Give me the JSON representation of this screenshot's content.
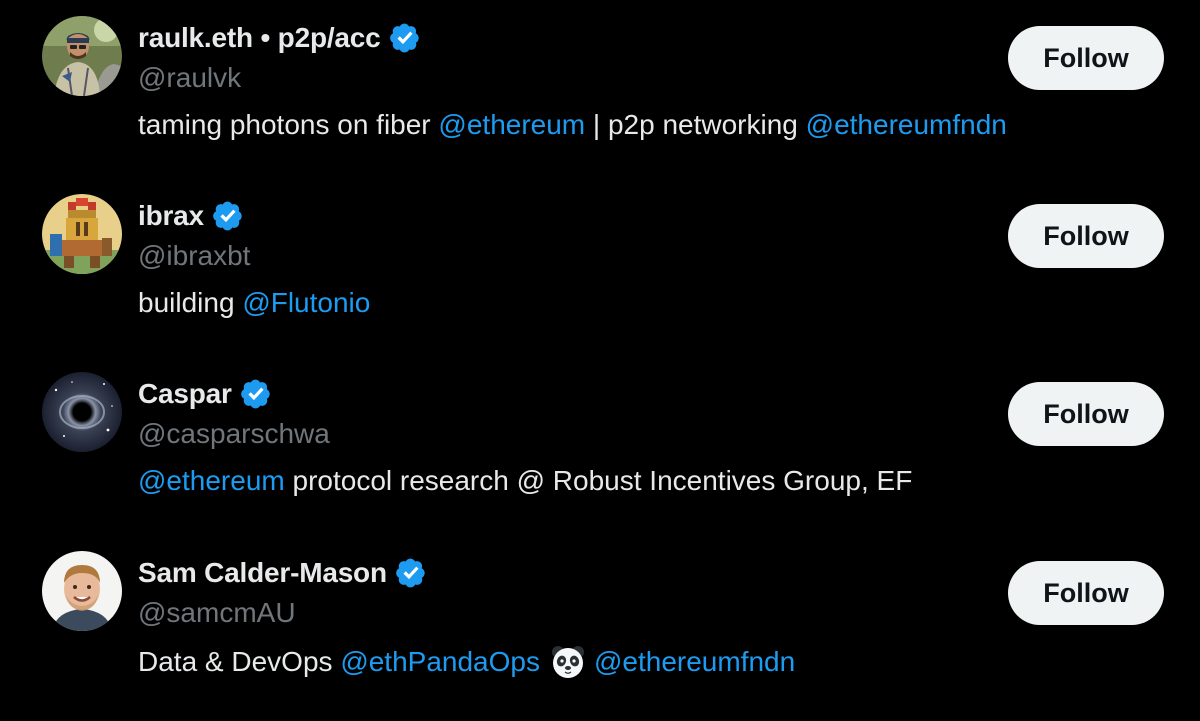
{
  "colors": {
    "background": "#000000",
    "name_text": "#e7e9ea",
    "handle_text": "#71767b",
    "mention_link": "#1d9bf0",
    "verified_badge": "#1d9bf0",
    "follow_button_bg": "#eff3f4",
    "follow_button_text": "#0f1419"
  },
  "users": [
    {
      "name": "raulk.eth • p2p/acc",
      "handle": "@raulvk",
      "verified_icon": "verified-badge-icon",
      "follow_label": "Follow",
      "bio": {
        "text_1": "taming photons on fiber ",
        "mention_1": "@ethereum",
        "text_2": " | p2p networking ",
        "mention_2": "@ethereumfndn"
      }
    },
    {
      "name": "ibrax",
      "handle": "@ibraxbt",
      "verified_icon": "verified-badge-icon",
      "follow_label": "Follow",
      "bio": {
        "text_1": "building ",
        "mention_1": "@Flutonio"
      }
    },
    {
      "name": "Caspar",
      "handle": "@casparschwa",
      "verified_icon": "verified-badge-icon",
      "follow_label": "Follow",
      "bio": {
        "mention_1": "@ethereum",
        "text_1": " protocol research @ Robust Incentives Group, EF"
      }
    },
    {
      "name": "Sam Calder-Mason",
      "handle": "@samcmAU",
      "verified_icon": "verified-badge-icon",
      "follow_label": "Follow",
      "bio": {
        "text_1": "Data & DevOps ",
        "mention_1": "@ethPandaOps",
        "emoji": "panda-face-icon",
        "mention_2": "@ethereumfndn"
      }
    }
  ]
}
